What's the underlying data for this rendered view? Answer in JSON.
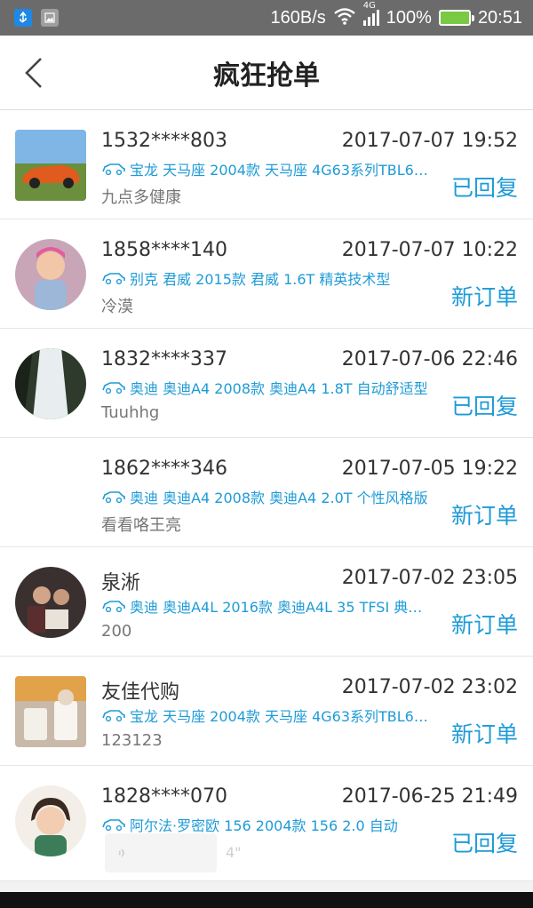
{
  "status_bar": {
    "net_speed": "160B/s",
    "network": "4G",
    "battery_pct": "100%",
    "clock": "20:51"
  },
  "header": {
    "title": "疯狂抢单"
  },
  "orders": [
    {
      "name": "1532****803",
      "time": "2017-07-07 19:52",
      "car": "宝龙 天马座 2004款 天马座 4G63系列TBL65...",
      "note": "九点多健康",
      "status": "已回复",
      "thumb": "car-photo"
    },
    {
      "name": "1858****140",
      "time": "2017-07-07 10:22",
      "car": "别克 君威 2015款 君威 1.6T 精英技术型",
      "note": "冷漠",
      "status": "新订单",
      "thumb": "child-avatar"
    },
    {
      "name": "1832****337",
      "time": "2017-07-06 22:46",
      "car": "奥迪 奥迪A4 2008款 奥迪A4 1.8T 自动舒适型",
      "note": "Tuuhhg",
      "status": "已回复",
      "thumb": "waterfall-avatar"
    },
    {
      "name": "1862****346",
      "time": "2017-07-05 19:22",
      "car": "奥迪 奥迪A4 2008款 奥迪A4 2.0T 个性风格版",
      "note": "看看咯王亮",
      "status": "新订单",
      "thumb": "none"
    },
    {
      "name": "泉淅",
      "time": "2017-07-02 23:05",
      "car": "奥迪 奥迪A4L 2016款 奥迪A4L 35 TFSI 典藏...",
      "note": "200",
      "status": "新订单",
      "thumb": "family-avatar"
    },
    {
      "name": "友佳代购",
      "time": "2017-07-02 23:02",
      "car": "宝龙 天马座 2004款 天马座 4G63系列TBL65...",
      "note": "123123",
      "status": "新订单",
      "thumb": "coffee-photo"
    },
    {
      "name": "1828****070",
      "time": "2017-06-25 21:49",
      "car": "阿尔法·罗密欧 156 2004款 156 2.0 自动",
      "note": "",
      "status": "已回复",
      "thumb": "girl-avatar",
      "voice_duration": "4\""
    }
  ],
  "colors": {
    "accent": "#1e9bd7",
    "status_bar_bg": "#6b6b6b"
  },
  "icons": {
    "back": "chevron-left-icon",
    "car": "car-icon",
    "voice": "voice-icon"
  }
}
